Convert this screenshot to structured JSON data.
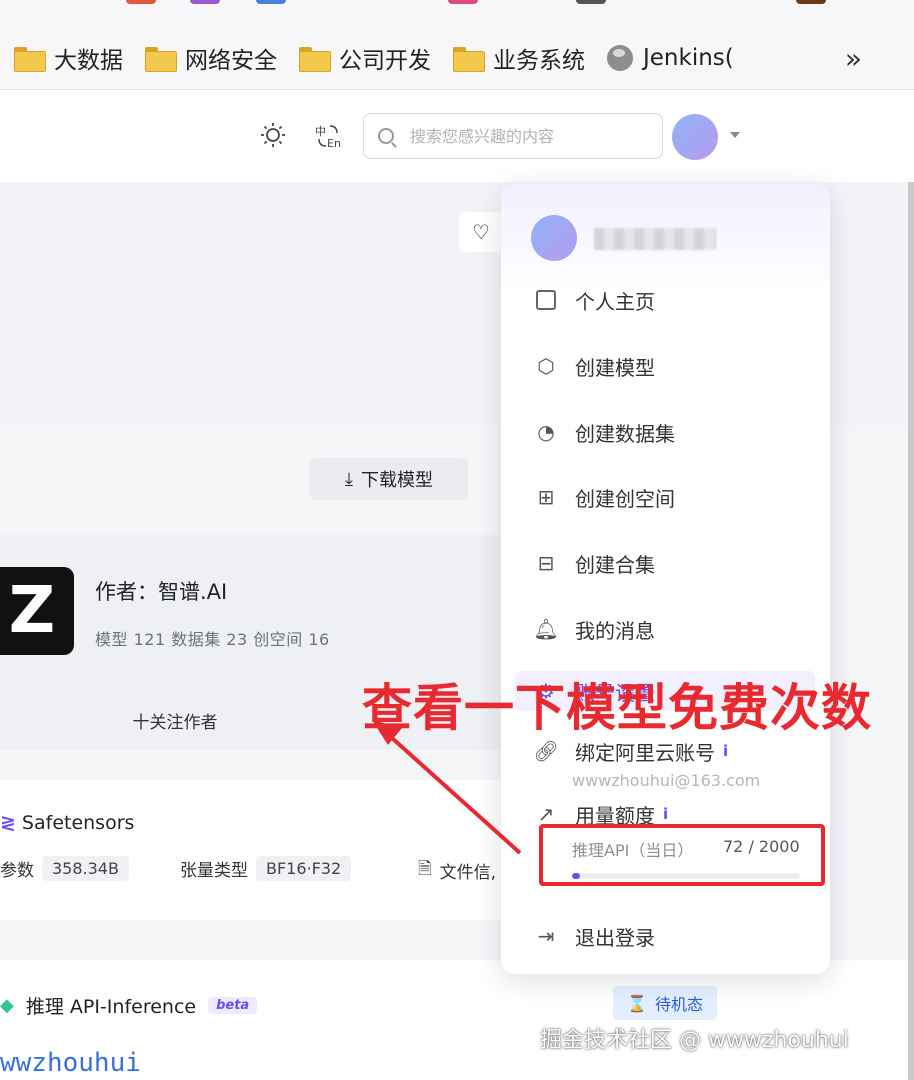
{
  "bookmarks": [
    {
      "label": "大数据",
      "icon": "folder-icon"
    },
    {
      "label": "网络安全",
      "icon": "folder-icon"
    },
    {
      "label": "公司开发",
      "icon": "folder-icon"
    },
    {
      "label": "业务系统",
      "icon": "folder-icon"
    },
    {
      "label": "Jenkins(",
      "icon": "globe-icon"
    }
  ],
  "bookmarks_more": "»",
  "header": {
    "search_placeholder": "搜索您感兴趣的内容",
    "theme_icon": "sun-icon",
    "lang_icon": "language-switch-icon"
  },
  "model": {
    "download_label": "下载模型",
    "author_name": "作者：智谱.AI",
    "author_stats": "模型 121  数据集 23  创空间 16",
    "logo_letter": "Z",
    "follow_label": "十关注作者",
    "format": "Safetensors",
    "params_label": "参数",
    "params_value": "358.34B",
    "tensor_label": "张量类型",
    "tensor_value": "BF16·F32",
    "file_info_label": "文件信,",
    "inference_title": "推理 API-Inference",
    "beta_label": "beta",
    "standby_label": "待机态",
    "username_partial": "wwzhouhui"
  },
  "user_menu": {
    "items": [
      {
        "label": "个人主页",
        "icon": "home-page-icon"
      },
      {
        "label": "创建模型",
        "icon": "cube-icon"
      },
      {
        "label": "创建数据集",
        "icon": "pie-chart-icon"
      },
      {
        "label": "创建创空间",
        "icon": "add-space-icon"
      },
      {
        "label": "创建合集",
        "icon": "collection-icon"
      },
      {
        "label": "我的消息",
        "icon": "bell-icon"
      },
      {
        "label": "账号设置",
        "icon": "settings-icon"
      },
      {
        "label": "绑定阿里云账号",
        "icon": "link-icon"
      },
      {
        "label": "用量额度",
        "icon": "trend-icon"
      },
      {
        "label": "退出登录",
        "icon": "logout-icon"
      }
    ],
    "email": "wwwzhouhui@163.com",
    "quota_label": "推理API（当日）",
    "quota_value": "72 / 2000",
    "quota_used": 72,
    "quota_total": 2000,
    "info_mark": "i"
  },
  "annotation": {
    "text": "查看一下模型免费次数",
    "color": "#e8292f"
  },
  "watermark": "掘金技术社区 @ wwwzhouhui",
  "colors": {
    "accent": "#6b4df0",
    "annotation_red": "#e8292f",
    "standby_blue": "#2b5fd9"
  }
}
